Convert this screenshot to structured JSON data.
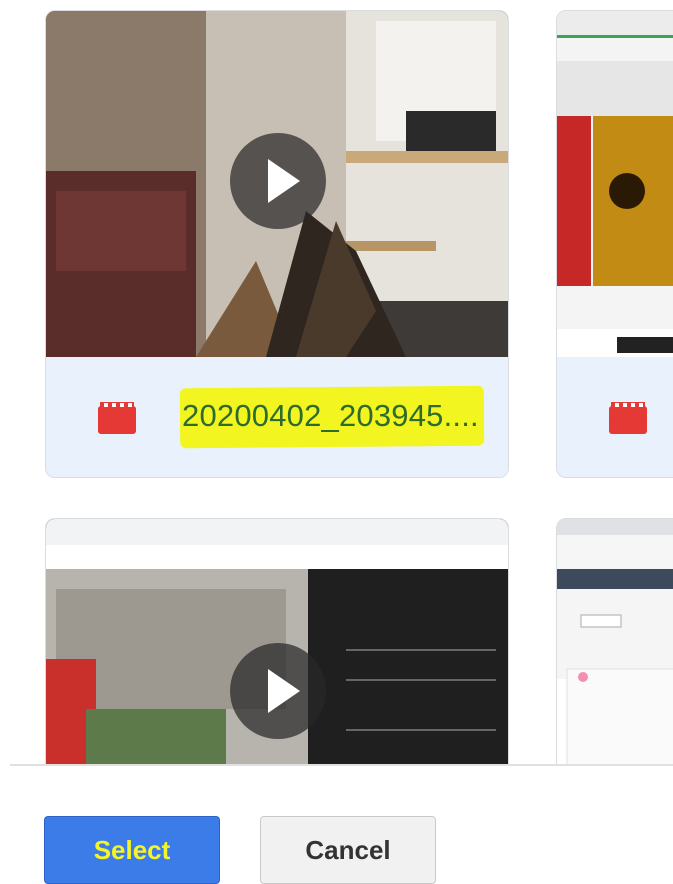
{
  "files": [
    {
      "name": "20200402_203945....",
      "type": "video",
      "icon": "video-file-icon"
    },
    {
      "name": "",
      "type": "video",
      "icon": "video-file-icon"
    },
    {
      "name": "",
      "type": "video"
    },
    {
      "name": "",
      "type": "image"
    }
  ],
  "actions": {
    "select_label": "Select",
    "cancel_label": "Cancel"
  },
  "colors": {
    "accent": "#3b7ce9",
    "highlight": "#f2f51f",
    "film_icon": "#e53935"
  }
}
